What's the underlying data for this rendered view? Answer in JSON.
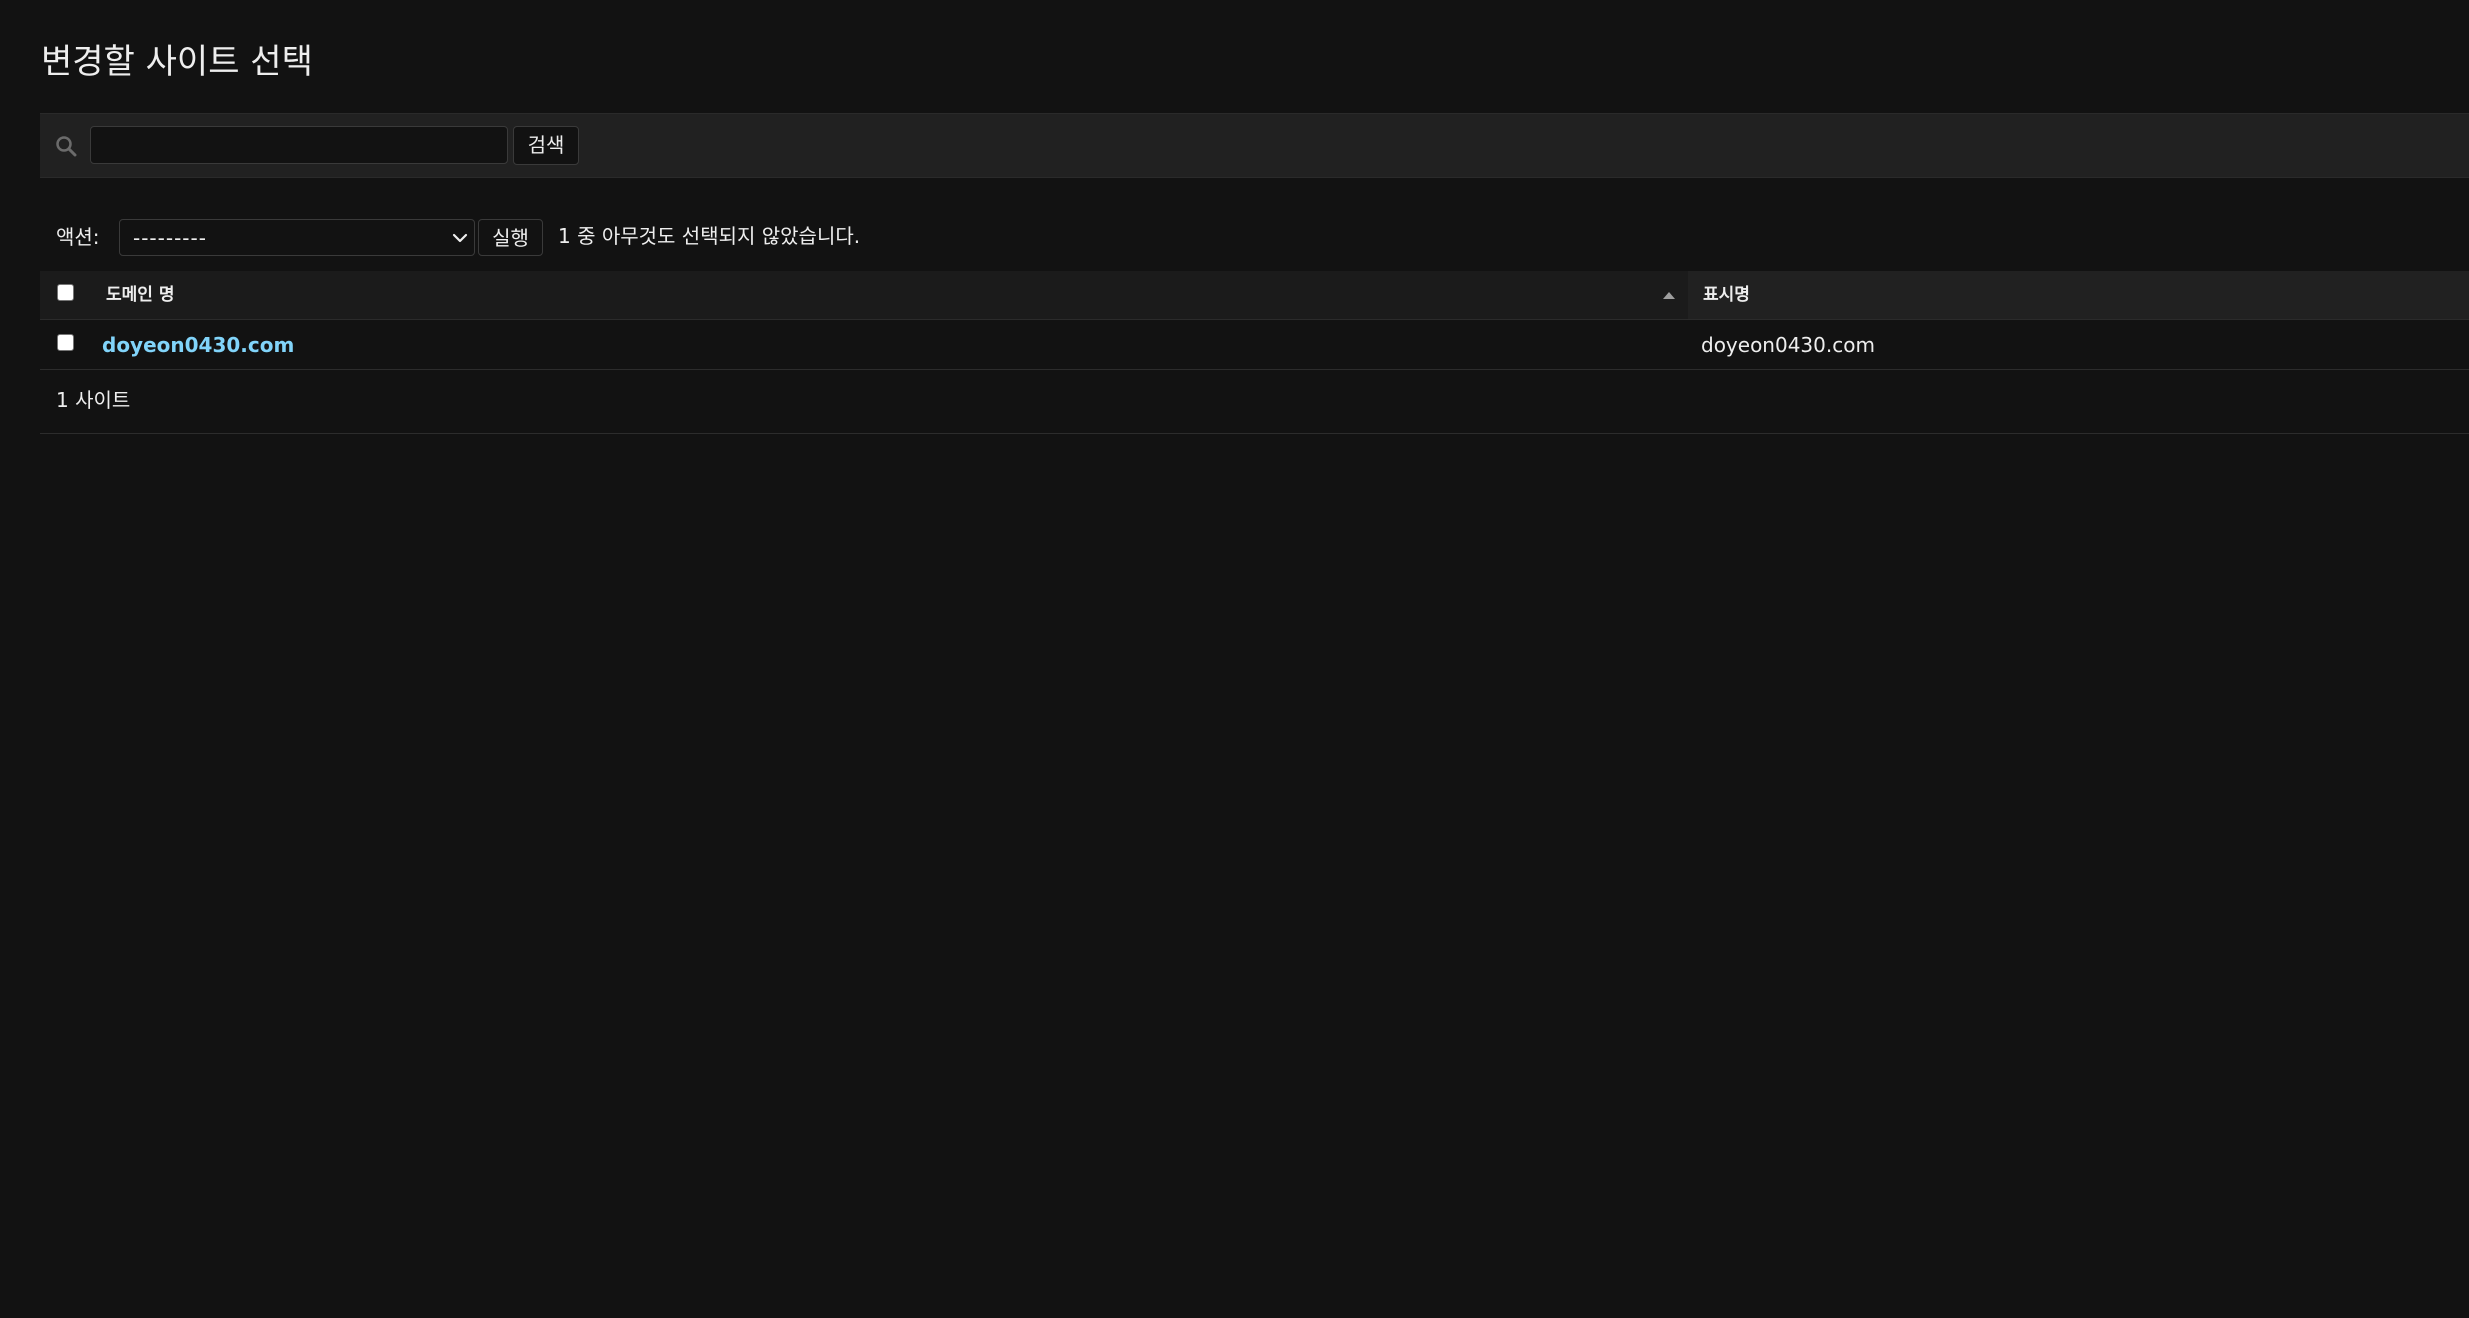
{
  "page": {
    "title": "변경할 사이트 선택"
  },
  "search": {
    "value": "",
    "button_label": "검색"
  },
  "actions": {
    "label": "액션:",
    "selected_option": "---------",
    "run_label": "실행",
    "selection_counter": "1 중 아무것도 선택되지 않았습니다."
  },
  "table": {
    "columns": [
      {
        "label": "도메인 명",
        "sorted": "ascending"
      },
      {
        "label": "표시명"
      }
    ],
    "rows": [
      {
        "domain": "doyeon0430.com",
        "display_name": "doyeon0430.com",
        "checked": false
      }
    ]
  },
  "paginator": {
    "text": "1 사이트"
  },
  "colors": {
    "background": "#121212",
    "link": "#81d4fa",
    "text": "#eeeeee",
    "toolbar": "#212121"
  },
  "icons": {
    "search": "search-icon",
    "select": "chevron-down-icon",
    "sort": "sort-asc-icon"
  }
}
